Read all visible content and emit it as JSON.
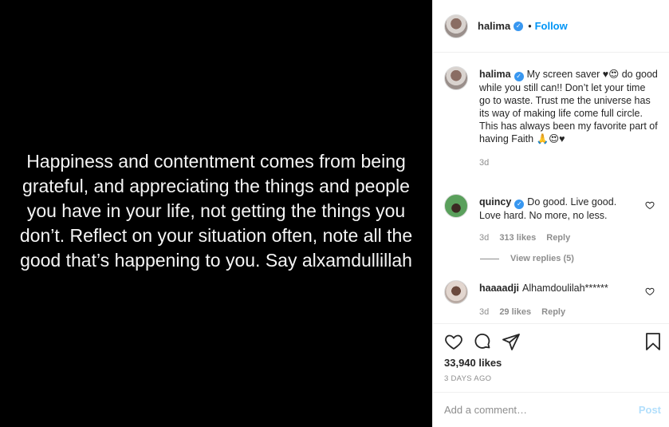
{
  "media": {
    "text": "Happiness and contentment comes from being grateful, and appreciating the things and people you have in your life, not getting the things you don’t. Reflect on your situation often, note all the good that’s happening to you. Say alxamdullillah"
  },
  "header": {
    "username": "halima",
    "separator": "•",
    "follow_label": "Follow"
  },
  "caption": {
    "username": "halima",
    "text": "My screen saver ♥😍 do good while you still can!! Don’t let your time go to waste. Trust me the universe has its way of making life come full circle. This has always been my favorite part of having Faith 🙏😍♥",
    "time": "3d"
  },
  "comments": [
    {
      "username": "quincy",
      "text": "Do good. Live good. Love hard. No more, no less.",
      "time": "3d",
      "likes": "313 likes",
      "reply_label": "Reply",
      "view_replies": "View replies (5)"
    },
    {
      "username": "haaaadji",
      "text": "Alhamdoulilah******",
      "time": "3d",
      "likes": "29 likes",
      "reply_label": "Reply"
    }
  ],
  "actions": {
    "likes": "33,940 likes",
    "time_ago": "3 DAYS AGO",
    "icons": [
      "heart-icon",
      "comment-icon",
      "share-icon",
      "bookmark-icon"
    ]
  },
  "add_comment": {
    "placeholder": "Add a comment…",
    "post_label": "Post"
  },
  "colors": {
    "accent": "#0095f6",
    "verified": "#3897f0",
    "muted": "#8e8e8e",
    "post_disabled": "#b2dffc"
  }
}
